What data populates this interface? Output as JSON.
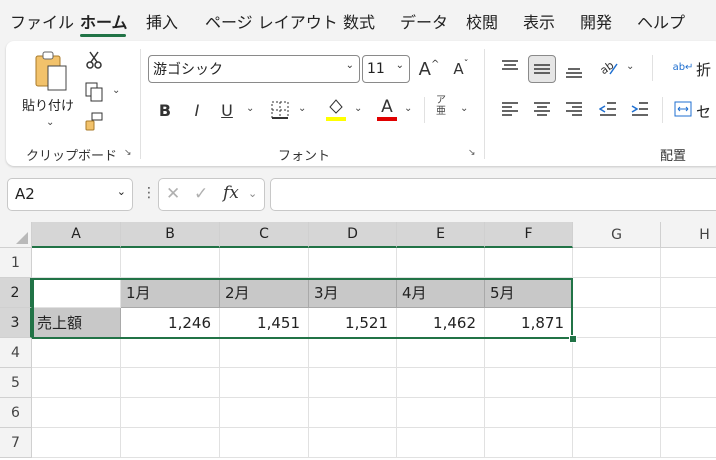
{
  "menu": {
    "tabs": [
      "ファイル",
      "ホーム",
      "挿入",
      "ページ レイアウト",
      "数式",
      "データ",
      "校閲",
      "表示",
      "開発",
      "ヘルプ"
    ],
    "active": "ホーム"
  },
  "ribbon": {
    "clipboard": {
      "paste_label": "貼り付け",
      "group_label": "クリップボード"
    },
    "font": {
      "font_name": "游ゴシック",
      "font_size": "11",
      "bold": "B",
      "italic": "I",
      "underline": "U",
      "font_color_glyph": "A",
      "phonetic_top": "ア",
      "phonetic_bottom": "亜",
      "grow_glyph": "A",
      "shrink_glyph": "A",
      "group_label": "フォント",
      "fill_color": "#ffff00",
      "font_color": "#e00000"
    },
    "alignment": {
      "group_label": "配置",
      "wrap_label": "折",
      "merge_label": "セ"
    }
  },
  "formula_bar": {
    "name_box": "A2",
    "fx": "fx",
    "formula": ""
  },
  "sheet": {
    "columns": [
      "A",
      "B",
      "C",
      "D",
      "E",
      "F",
      "G",
      "H"
    ],
    "rows": [
      "1",
      "2",
      "3",
      "4",
      "5",
      "6",
      "7"
    ],
    "cells": {
      "B2": "1月",
      "C2": "2月",
      "D2": "3月",
      "E2": "4月",
      "F2": "5月",
      "A3": "売上額",
      "B3": "1,246",
      "C3": "1,451",
      "D3": "1,521",
      "E3": "1,462",
      "F3": "1,871"
    },
    "accent_color": "#217346"
  }
}
